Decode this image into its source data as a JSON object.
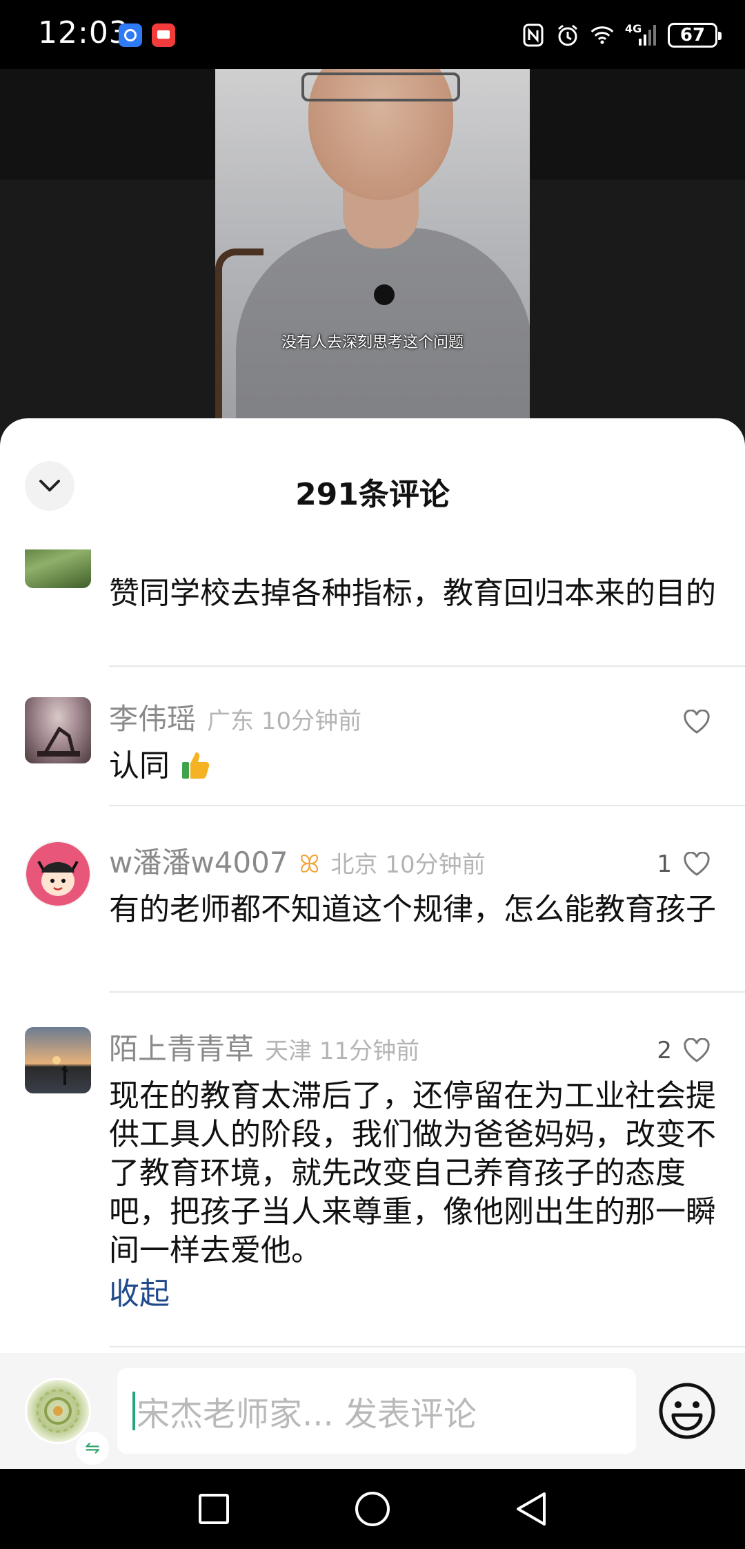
{
  "status_bar": {
    "time": "12:03",
    "network_label": "4G",
    "battery": "67",
    "icons": [
      "nfc-icon",
      "alarm-icon",
      "wifi-icon",
      "signal-icon"
    ]
  },
  "video": {
    "subtitle": "没有人去深刻思考这个问题"
  },
  "sheet": {
    "title": "291条评论"
  },
  "comments": [
    {
      "name": "",
      "meta": "",
      "text": "赞同学校去掉各种指标，教育回归本来的目的",
      "likes": ""
    },
    {
      "name": "李伟瑶",
      "meta": "广东 10分钟前",
      "text": "认同",
      "likes": ""
    },
    {
      "name": "w潘潘w4007",
      "badge": "ꕤ",
      "meta": "北京 10分钟前",
      "text": "有的老师都不知道这个规律，怎么能教育孩子",
      "likes": "1"
    },
    {
      "name": "陌上青青草",
      "meta": "天津 11分钟前",
      "text": "现在的教育太滞后了，还停留在为工业社会提供工具人的阶段，我们做为爸爸妈妈，改变不了教育环境，就先改变自己养育孩子的态度吧，把孩子当人来尊重，像他刚出生的那一瞬间一样去爱他。",
      "likes": "2",
      "collapse_label": "收起"
    }
  ],
  "input": {
    "placeholder": "宋杰老师家... 发表评论"
  },
  "colors": {
    "accent_caret": "#24a67a",
    "link": "#1f4a8c",
    "badge": "#f0a53a"
  }
}
